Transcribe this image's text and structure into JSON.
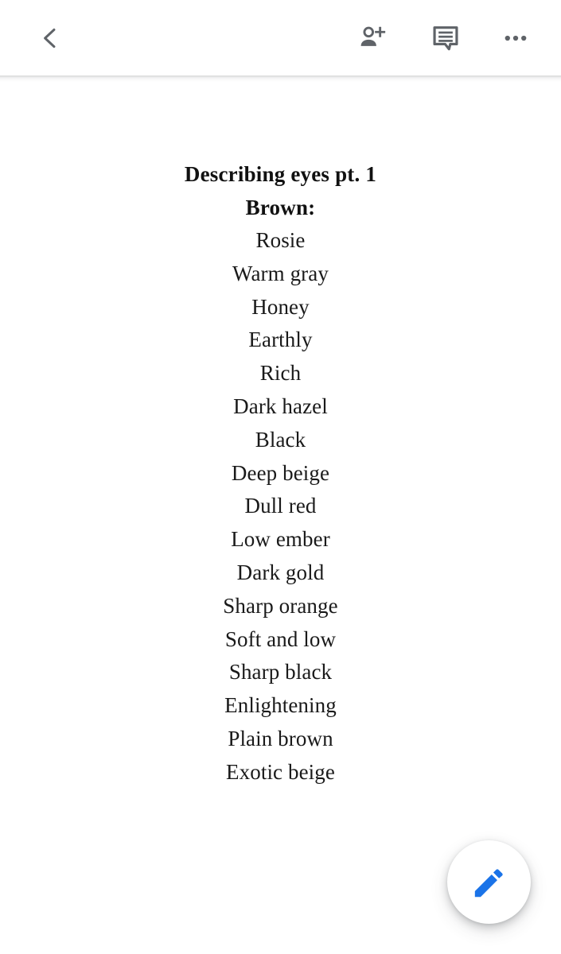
{
  "appbar": {
    "back_button": {
      "icon": "chevron-left-icon",
      "label": "Back"
    },
    "actions": [
      {
        "icon": "person-add-icon",
        "label": "Add people"
      },
      {
        "icon": "comment-icon",
        "label": "Comments"
      },
      {
        "icon": "more-vert-icon",
        "label": "More options"
      }
    ],
    "icon_color": "#5f6368"
  },
  "document": {
    "title": "Describing eyes pt. 1",
    "subtitle": "Brown:",
    "lines": [
      "Rosie",
      "Warm gray",
      "Honey",
      "Earthly",
      "Rich",
      "Dark hazel",
      "Black",
      "Deep beige",
      "Dull red",
      "Low ember",
      "Dark gold",
      "Sharp orange",
      "Soft and low",
      "Sharp black",
      "Enlightening",
      "Plain brown",
      "Exotic beige"
    ],
    "text_color": "#1a1a1a",
    "background": "#ffffff"
  },
  "fab": {
    "icon": "edit-pencil-icon",
    "label": "Edit",
    "icon_color": "#1a73e8",
    "background": "#ffffff"
  }
}
